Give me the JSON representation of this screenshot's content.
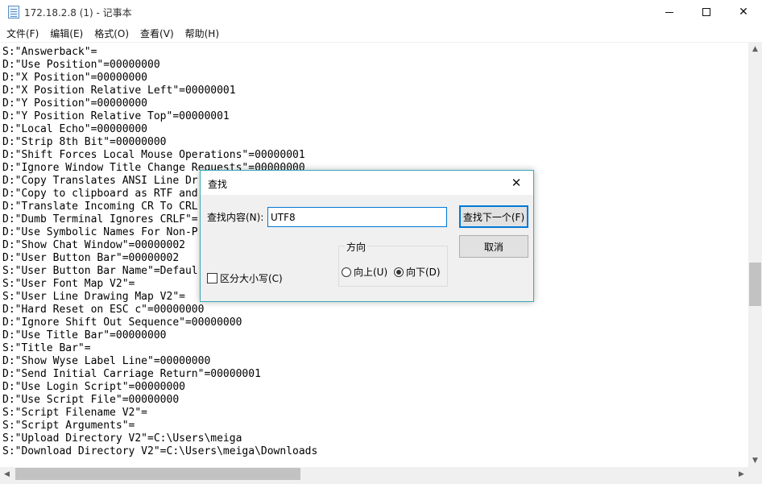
{
  "window": {
    "title": "172.18.2.8 (1) - 记事本",
    "controls": {
      "minimize": "minimize",
      "maximize": "maximize",
      "close": "✕"
    }
  },
  "menu": [
    {
      "label": "文件(F)"
    },
    {
      "label": "编辑(E)"
    },
    {
      "label": "格式(O)"
    },
    {
      "label": "查看(V)"
    },
    {
      "label": "帮助(H)"
    }
  ],
  "editor": {
    "lines": [
      "S:\"Answerback\"=",
      "D:\"Use Position\"=00000000",
      "D:\"X Position\"=00000000",
      "D:\"X Position Relative Left\"=00000001",
      "D:\"Y Position\"=00000000",
      "D:\"Y Position Relative Top\"=00000001",
      "D:\"Local Echo\"=00000000",
      "D:\"Strip 8th Bit\"=00000000",
      "D:\"Shift Forces Local Mouse Operations\"=00000001",
      "D:\"Ignore Window Title Change Requests\"=00000000",
      "D:\"Copy Translates ANSI Line Dr",
      "D:\"Copy to clipboard as RTF and",
      "D:\"Translate Incoming CR To CRL",
      "D:\"Dumb Terminal Ignores CRLF\"=",
      "D:\"Use Symbolic Names For Non-P",
      "D:\"Show Chat Window\"=00000002",
      "D:\"User Button Bar\"=00000002",
      "S:\"User Button Bar Name\"=Defaul",
      "S:\"User Font Map V2\"=",
      "S:\"User Line Drawing Map V2\"=",
      "D:\"Hard Reset on ESC c\"=00000000",
      "D:\"Ignore Shift Out Sequence\"=00000000",
      "D:\"Use Title Bar\"=00000000",
      "S:\"Title Bar\"=",
      "D:\"Show Wyse Label Line\"=00000000",
      "D:\"Send Initial Carriage Return\"=00000001",
      "D:\"Use Login Script\"=00000000",
      "D:\"Use Script File\"=00000000",
      "S:\"Script Filename V2\"=",
      "S:\"Script Arguments\"=",
      "S:\"Upload Directory V2\"=C:\\Users\\meiga",
      "S:\"Download Directory V2\"=C:\\Users\\meiga\\Downloads"
    ]
  },
  "find_dialog": {
    "title": "查找",
    "close_glyph": "✕",
    "find_label": "查找内容(N):",
    "find_value": "UTF8",
    "find_next_label": "查找下一个(F)",
    "cancel_label": "取消",
    "direction_label": "方向",
    "direction_up_label": "向上(U)",
    "direction_down_label": "向下(D)",
    "direction_selected": "down",
    "match_case_label": "区分大小写(C)",
    "match_case_checked": false
  },
  "scrollbars": {
    "up_arrow": "▲",
    "down_arrow": "▼",
    "left_arrow": "◀",
    "right_arrow": "▶"
  }
}
